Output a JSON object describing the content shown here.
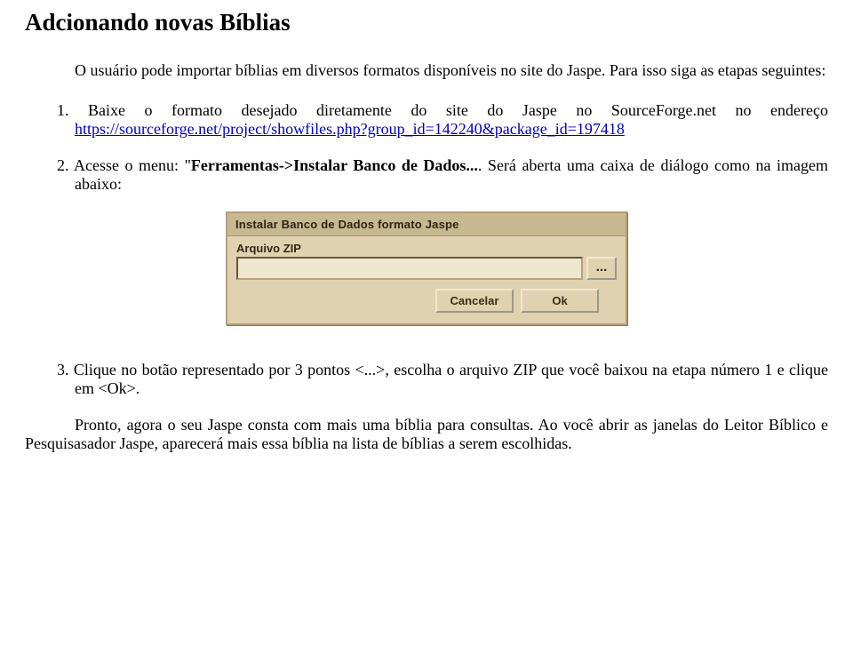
{
  "title": "Adcionando novas Bíblias",
  "intro_prefix": "O usuário pode importar bíblias em diversos formatos disponíveis no site do Jaspe. Para isso siga as etapas seguintes:",
  "steps": {
    "s1_num": "1.",
    "s1_before_link": " Baixe o formato desejado diretamente do site do Jaspe no SourceForge.net no endereço ",
    "s1_link": "https://sourceforge.net/project/showfiles.php?group_id=142240&package_id=197418",
    "s2_num": "2.",
    "s2_before_bold": " Acesse o menu: \"",
    "s2_bold": "Ferramentas->Instalar Banco de Dados...",
    "s2_after_bold": ". Será aberta uma caixa de diálogo como na imagem abaixo:",
    "s3_num": "3.",
    "s3_text": " Clique no botão representado por 3 pontos <...>, escolha o arquivo ZIP que você baixou na etapa número 1 e clique em <Ok>."
  },
  "dialog": {
    "title": "Instalar Banco de Dados formato Jaspe",
    "field_label": "Arquivo ZIP",
    "browse_label": "...",
    "cancel": "Cancelar",
    "ok": "Ok"
  },
  "conclusion": "Pronto, agora o seu Jaspe consta com mais uma bíblia para consultas. Ao você abrir as janelas do Leitor Bíblico e Pesquisasador Jaspe, aparecerá mais essa bíblia na lista de bíblias a serem escolhidas."
}
